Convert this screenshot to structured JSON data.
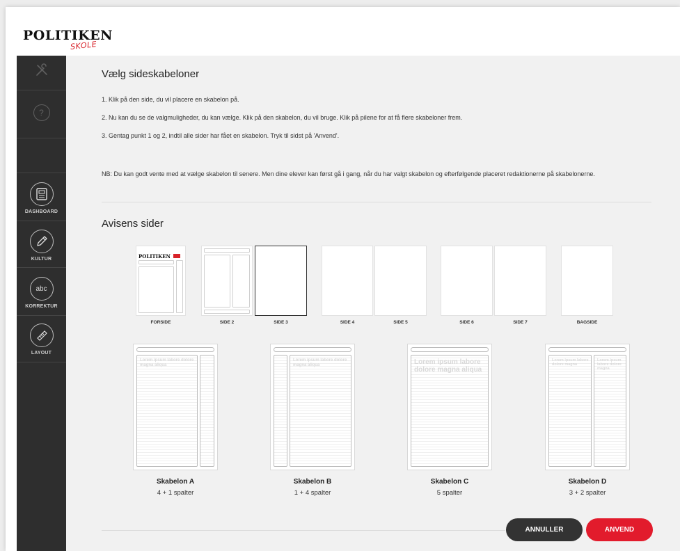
{
  "brand": {
    "name": "POLITIKEN",
    "sub": "SKOLE"
  },
  "sidebar": {
    "items": [
      {
        "icon": "tools-icon",
        "label": ""
      },
      {
        "icon": "help-icon",
        "label": ""
      },
      {
        "icon": "dashboard-icon",
        "label": "DASHBOARD"
      },
      {
        "icon": "pencil-icon",
        "label": "KULTUR"
      },
      {
        "icon": "spellcheck-icon",
        "label": "KORREKTUR"
      },
      {
        "icon": "ruler-icon",
        "label": "LAYOUT"
      }
    ]
  },
  "header": {
    "title": "Vælg sideskabeloner"
  },
  "instructions": [
    "1. Klik på den side, du vil placere en skabelon på.",
    "2. Nu kan du se de valgmuligheder, du kan vælge. Klik på den skabelon, du vil bruge. Klik på pilene for at få flere skabeloner frem.",
    "3. Gentag punkt 1 og 2, indtil alle sider har fået en skabelon. Tryk til sidst på 'Anvend'.",
    "NB: Du kan godt vente med at vælge skabelon til senere. Men dine elever kan først gå i gang, når du har valgt skabelon og efterfølgende placeret redaktionerne på skabelonerne."
  ],
  "pages_section": {
    "title": "Avisens sider",
    "pages": [
      "FORSIDE",
      "SIDE 2",
      "SIDE 3",
      "SIDE 4",
      "SIDE 5",
      "SIDE 6",
      "SIDE 7",
      "BAGSIDE"
    ],
    "forside_logo": "POLITIKEN",
    "selected": "SIDE 3"
  },
  "templates": [
    {
      "name": "Skabelon A",
      "desc": "4 + 1 spalter",
      "filler": "Lorem ipsum labore dolore magna aliqua"
    },
    {
      "name": "Skabelon B",
      "desc": "1 + 4 spalter",
      "filler": "Lorem ipsum labore dolore magna aliqua"
    },
    {
      "name": "Skabelon C",
      "desc": "5 spalter",
      "filler": "Lorem ipsum labore dolore magna aliqua"
    },
    {
      "name": "Skabelon D",
      "desc": "3 + 2 spalter",
      "filler": "Lorem ipsum labore dolore magna"
    }
  ],
  "actions": {
    "cancel": "ANNULLER",
    "apply": "ANVEND"
  },
  "colors": {
    "accent": "#e21b2c",
    "sidebar": "#2e2e2e",
    "dark_button": "#333333"
  }
}
